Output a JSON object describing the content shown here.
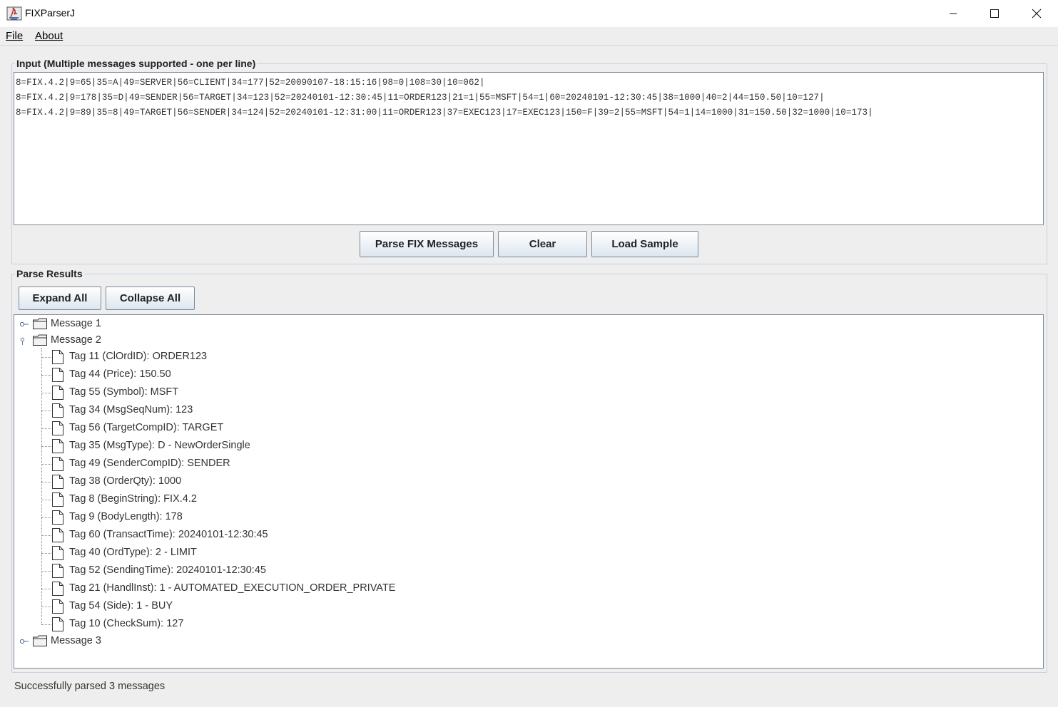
{
  "window": {
    "title": "FIXParserJ"
  },
  "menu": {
    "items": [
      {
        "label": "File"
      },
      {
        "label": "About"
      }
    ]
  },
  "input_panel": {
    "title": "Input (Multiple messages supported - one per line)",
    "lines": [
      "8=FIX.4.2|9=65|35=A|49=SERVER|56=CLIENT|34=177|52=20090107-18:15:16|98=0|108=30|10=062|",
      "8=FIX.4.2|9=178|35=D|49=SENDER|56=TARGET|34=123|52=20240101-12:30:45|11=ORDER123|21=1|55=MSFT|54=1|60=20240101-12:30:45|38=1000|40=2|44=150.50|10=127|",
      "8=FIX.4.2|9=89|35=8|49=TARGET|56=SENDER|34=124|52=20240101-12:31:00|11=ORDER123|37=EXEC123|17=EXEC123|150=F|39=2|55=MSFT|54=1|14=1000|31=150.50|32=1000|10=173|"
    ],
    "buttons": {
      "parse": "Parse FIX Messages",
      "clear": "Clear",
      "load_sample": "Load Sample"
    }
  },
  "results_panel": {
    "title": "Parse Results",
    "buttons": {
      "expand_all": "Expand All",
      "collapse_all": "Collapse All"
    },
    "tree": {
      "message1": "Message 1",
      "message2": "Message 2",
      "message3": "Message 3",
      "message2_fields": [
        "Tag 11 (ClOrdID): ORDER123",
        "Tag 44 (Price): 150.50",
        "Tag 55 (Symbol): MSFT",
        "Tag 34 (MsgSeqNum): 123",
        "Tag 56 (TargetCompID): TARGET",
        "Tag 35 (MsgType): D - NewOrderSingle",
        "Tag 49 (SenderCompID): SENDER",
        "Tag 38 (OrderQty): 1000",
        "Tag 8 (BeginString): FIX.4.2",
        "Tag 9 (BodyLength): 178",
        "Tag 60 (TransactTime): 20240101-12:30:45",
        "Tag 40 (OrdType): 2 - LIMIT",
        "Tag 52 (SendingTime): 20240101-12:30:45",
        "Tag 21 (HandlInst): 1 - AUTOMATED_EXECUTION_ORDER_PRIVATE",
        "Tag 54 (Side): 1 - BUY",
        "Tag 10 (CheckSum): 127"
      ]
    }
  },
  "status": {
    "text": "Successfully parsed 3 messages"
  }
}
